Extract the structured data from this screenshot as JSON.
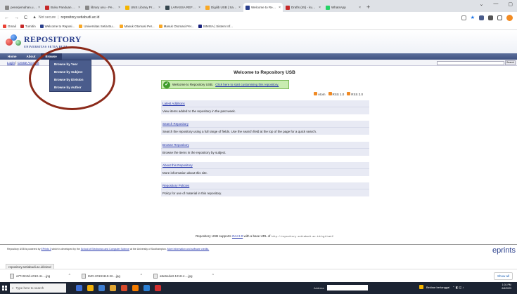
{
  "browser": {
    "tabs": [
      {
        "title": "penerjemahan.unu - Y",
        "color": "#888888"
      },
      {
        "title": "Buku Panduan Penyu",
        "color": "#c62828"
      },
      {
        "title": "library unu - Penelusu",
        "color": "#888888"
      },
      {
        "title": "UNS Library Profile",
        "color": "#f4b400"
      },
      {
        "title": "LARASSA REFERENS",
        "color": "#37474f"
      },
      {
        "title": "Digilib USB | Sarajan",
        "color": "#f9a825"
      },
      {
        "title": "Welcome to Reposito",
        "color": "#2a3f8c"
      },
      {
        "title": "Drafts (45) - kumirr",
        "color": "#c62828"
      },
      {
        "title": "WhatsApp",
        "color": "#25d366"
      }
    ],
    "new_tab": "+",
    "window_controls": [
      "⌄",
      "—",
      "▢"
    ],
    "nav": {
      "back": "←",
      "forward": "→",
      "reload": "C"
    },
    "omnibox": {
      "security": "Not secure",
      "url": "repository.setiabudi.ac.id"
    },
    "bookmarks": [
      {
        "label": "Gmail",
        "color": "#ea4335"
      },
      {
        "label": "Turnitin",
        "color": "#c62828"
      },
      {
        "label": "Welcome to Reposi...",
        "color": "#2a3f8c"
      },
      {
        "label": "Universitas Setia Bu...",
        "color": "#f9a825"
      },
      {
        "label": "Masuk Otomasi Per...",
        "color": "#f9a825"
      },
      {
        "label": "Masuk Otomasi Per...",
        "color": "#f9a825"
      },
      {
        "label": "SIMISA | Sistem Inf...",
        "color": "#1a237e"
      }
    ]
  },
  "site": {
    "logo": {
      "name": "REPOSITORY",
      "subtitle": "UNIVERSITAS SETIA BUDI"
    },
    "menu": [
      "Home",
      "About",
      "Browse"
    ],
    "menu_selected": 2,
    "login": {
      "login": "Login",
      "create": "Create Account"
    },
    "search_button": "Search",
    "browse_dropdown": [
      "Browse by Year",
      "Browse by Subject",
      "Browse by Division",
      "Browse by Author"
    ],
    "page_title": "Welcome to Repository USB",
    "welcome": {
      "text": "Welcome to Repository USB.",
      "link": "Click here to start customising this repository."
    },
    "feeds": [
      "Atom",
      "RSS 1.0",
      "RSS 2.0"
    ],
    "panels": [
      {
        "title": "Latest Additions",
        "desc": "View items added to the repository in the past week."
      },
      {
        "title": "Search Repository",
        "desc": "Search the repository using a full range of fields. Use the search field at the top of the page for a quick search."
      },
      {
        "title": "Browse Repository",
        "desc": "Browse the items in the repository by subject."
      },
      {
        "title": "About this Repository",
        "desc": "More information about this site."
      },
      {
        "title": "Repository Policies",
        "desc": "Policy for use of material in this repository."
      }
    ],
    "oai": {
      "prefix": "Repository USB supports",
      "link": "OAI 2.0",
      "middle": "with a base URL of",
      "url": "http://repository.setiabudi.ac.id/cgi/oai2"
    },
    "footer": {
      "p1": "Repository USB is powered by",
      "eprints_link": "EPrints 3",
      "p2": "which is developed by the",
      "school_link": "School of Electronics and Computer Science",
      "p3": "at the University of Southampton.",
      "more_link": "More information and software credits."
    },
    "eprints_logo": "eprints"
  },
  "status_url": "repository.setiabudi.ac.id/view/",
  "downloads": {
    "items": [
      "a77c0c0d-4010-4c....jpg",
      "IMG-20191119-W....jpg",
      "a9e6eda3-1218-4....jpg"
    ],
    "show_all": "Show all"
  },
  "taskbar": {
    "search_placeholder": "Type here to search",
    "address_label": "Address",
    "weather": "Bekisar berlanggai",
    "time": "1:01 PM",
    "date": "6/6/2023",
    "app_colors": [
      "#3d6fd6",
      "#f2b10a",
      "#3e7ed2",
      "#e1a533",
      "#d64a2b",
      "#f57c00",
      "#2a7fd4",
      "#d32f2f"
    ]
  }
}
